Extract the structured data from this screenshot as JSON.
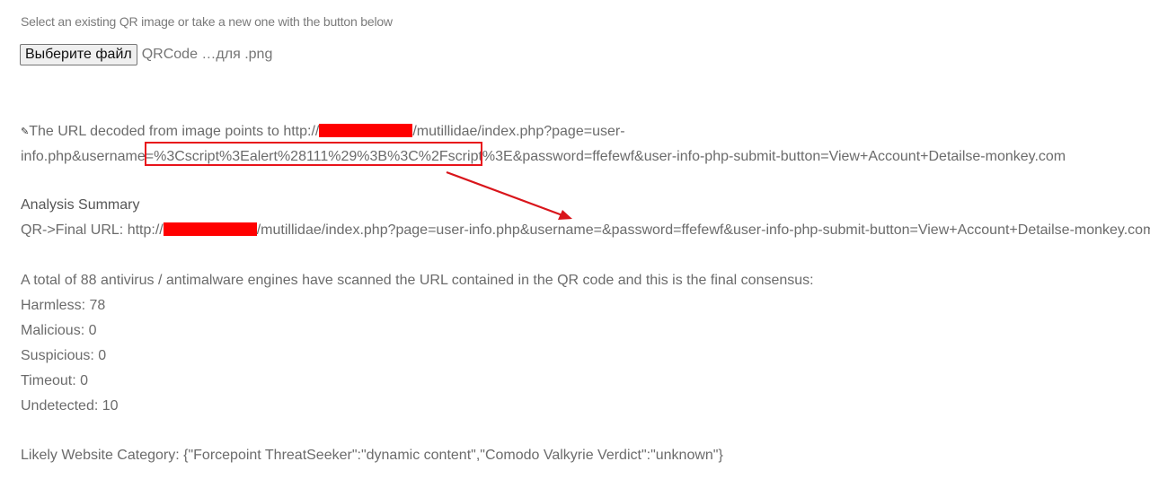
{
  "instructions": "Select an existing QR image or take a new one with the button below",
  "file_input": {
    "button_label": "Выберите файл",
    "file_name": "QRCode …для .png"
  },
  "decoded_url": {
    "prefix": "The URL decoded from image points to http://",
    "after_redact": "/mutillidae/index.php?page=user-",
    "line2_start": "info.php&username=",
    "payload": "%3Cscript%3Ealert%28111%29%3B%3C%2Fscript%3E",
    "line2_end": "&password=ffefewf&user-info-php-submit-button=View+Account+Detailse-monkey.com"
  },
  "analysis": {
    "title": "Analysis Summary",
    "final_url_prefix": "QR->Final URL: http://",
    "final_url_rest": "/mutillidae/index.php?page=user-info.php&username=&password=ffefewf&user-info-php-submit-button=View+Account+Detailse-monkey.com"
  },
  "scan": {
    "intro": "A total of 88 antivirus / antimalware engines have scanned the URL contained in the QR code and this is the final consensus:",
    "harmless": "Harmless: 78",
    "malicious": "Malicious: 0",
    "suspicious": "Suspicious: 0",
    "timeout": "Timeout: 0",
    "undetected": "Undetected: 10"
  },
  "category": "Likely Website Category: {\"Forcepoint ThreatSeeker\":\"dynamic content\",\"Comodo Valkyrie Verdict\":\"unknown\"}",
  "colors": {
    "redaction": "#ff0000",
    "highlight": "#e8141b",
    "arrow": "#d9151b"
  },
  "icons": {
    "link": "pencil-icon"
  }
}
